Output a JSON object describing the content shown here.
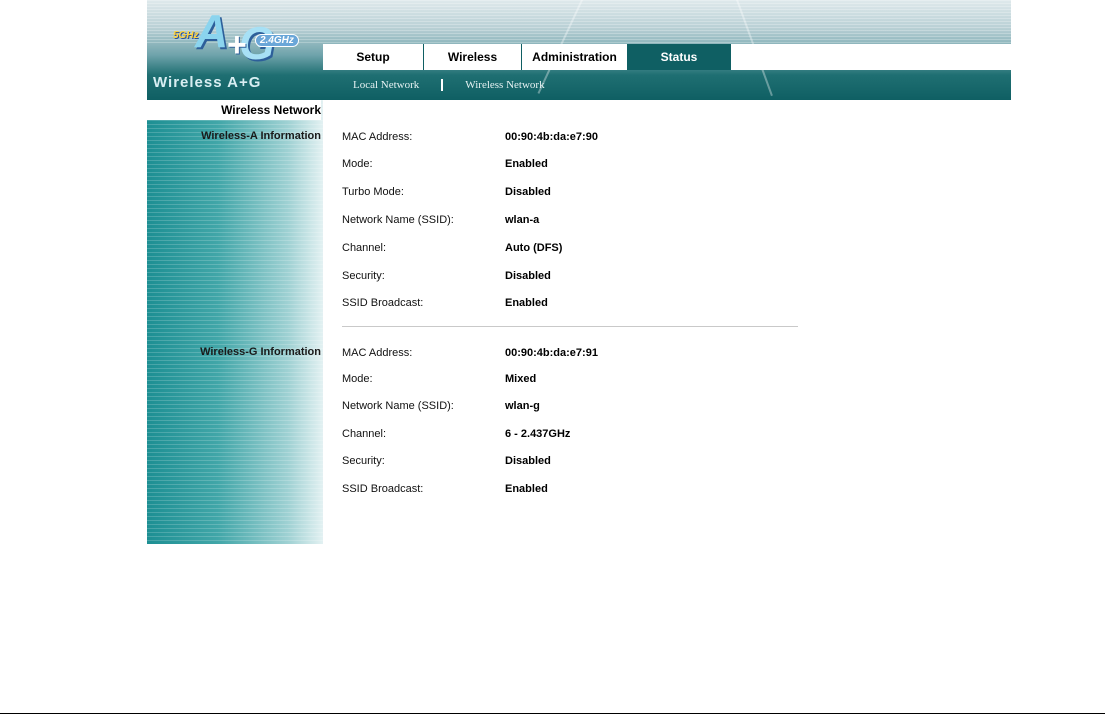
{
  "brand": {
    "band_5ghz": "5GHz",
    "letter_a": "A",
    "plus": "+",
    "letter_g": "G",
    "band_24ghz": "2.4GHz",
    "product_name": "Wireless A+G"
  },
  "tabs": [
    {
      "label": "Setup",
      "active": false
    },
    {
      "label": "Wireless",
      "active": false
    },
    {
      "label": "Administration",
      "active": false
    },
    {
      "label": "Status",
      "active": true
    }
  ],
  "subnav": {
    "items": [
      {
        "label": "Local Network"
      },
      {
        "label": "Wireless Network"
      }
    ]
  },
  "page": {
    "title": "Wireless Network"
  },
  "wireless_a": {
    "heading": "Wireless-A Information",
    "rows": [
      {
        "label": "MAC Address:",
        "value": "00:90:4b:da:e7:90"
      },
      {
        "label": "Mode:",
        "value": "Enabled"
      },
      {
        "label": "Turbo Mode:",
        "value": "Disabled"
      },
      {
        "label": "Network Name (SSID):",
        "value": "wlan-a"
      },
      {
        "label": "Channel:",
        "value": "Auto (DFS)"
      },
      {
        "label": "Security:",
        "value": "Disabled"
      },
      {
        "label": "SSID Broadcast:",
        "value": "Enabled"
      }
    ]
  },
  "wireless_g": {
    "heading": "Wireless-G Information",
    "rows": [
      {
        "label": "MAC Address:",
        "value": "00:90:4b:da:e7:91"
      },
      {
        "label": "Mode:",
        "value": "Mixed"
      },
      {
        "label": "Network Name (SSID):",
        "value": "wlan-g"
      },
      {
        "label": "Channel:",
        "value": "6 - 2.437GHz"
      },
      {
        "label": "Security:",
        "value": "Disabled"
      },
      {
        "label": "SSID Broadcast:",
        "value": "Enabled"
      }
    ]
  },
  "colors": {
    "header_teal": "#0f5f63",
    "active_tab_bg": "#0f5f63",
    "active_tab_text": "#ffffff"
  }
}
